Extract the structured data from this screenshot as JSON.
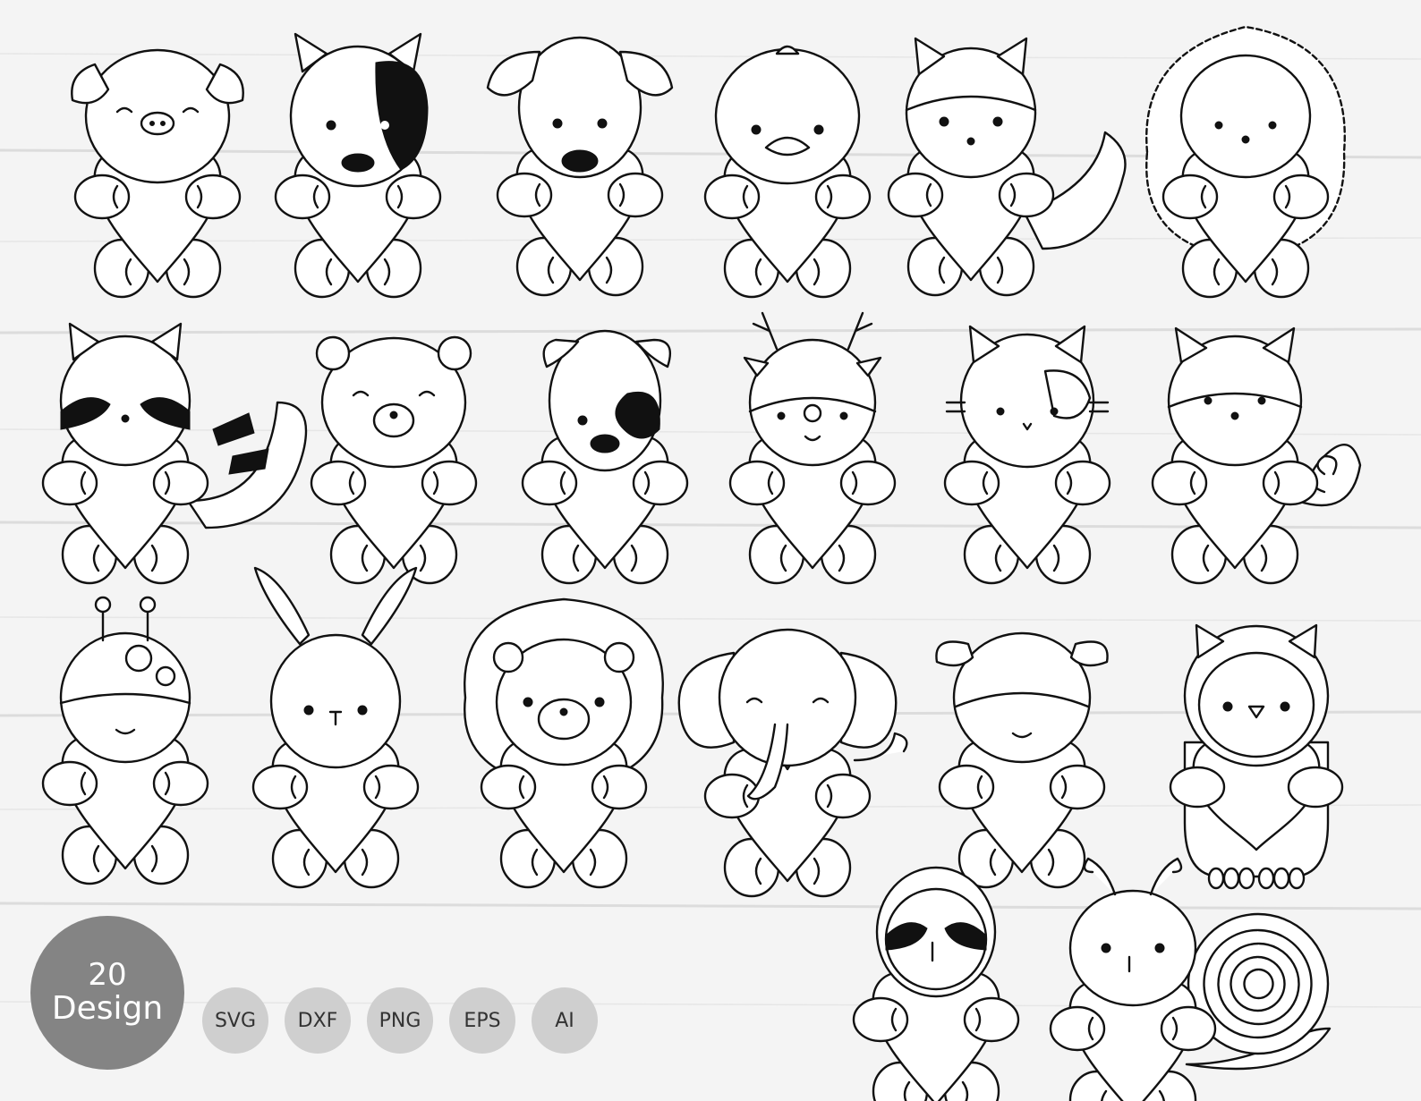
{
  "badge": {
    "count": "20",
    "label": "Design"
  },
  "formats": [
    "SVG",
    "DXF",
    "PNG",
    "EPS",
    "AI"
  ],
  "animals": [
    "pig",
    "dog-spotted",
    "puppy",
    "duckling",
    "fox",
    "hedgehog",
    "raccoon",
    "bear",
    "puppy-spotted",
    "reindeer",
    "cat",
    "squirrel",
    "giraffe",
    "bunny",
    "lion",
    "elephant",
    "cow",
    "owl",
    "sloth",
    "snail"
  ],
  "colors": {
    "background": "#f3f3f3",
    "badge": "#848484",
    "format_chip": "#cfcfcf",
    "line": "#111111"
  }
}
